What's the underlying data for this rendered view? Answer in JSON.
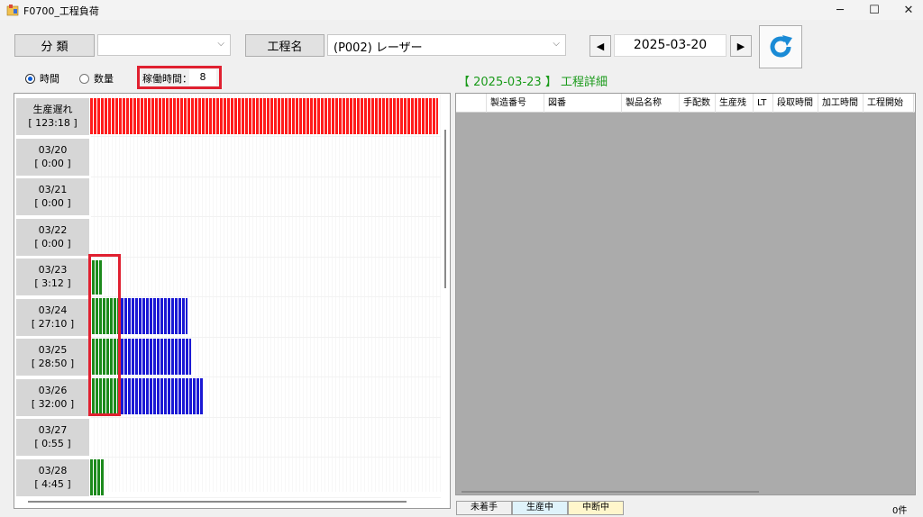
{
  "window": {
    "title": "F0700_工程負荷",
    "minimize": "─",
    "maximize": "☐",
    "close": "✕"
  },
  "toolbar": {
    "category_label": "分 類",
    "category_value": "",
    "process_label": "工程名",
    "process_value": "(P002) レーザー",
    "prev_icon": "◀",
    "date": "2025-03-20",
    "next_icon": "▶"
  },
  "options": {
    "time_label": "時間",
    "quantity_label": "数量",
    "selected": "time",
    "work_hours_label": "稼働時間：",
    "work_hours_value": "8"
  },
  "load_rows": [
    {
      "label": "生産遅れ",
      "total": "[ 123:18 ]"
    },
    {
      "label": "03/20",
      "total": "[ 0:00 ]"
    },
    {
      "label": "03/21",
      "total": "[ 0:00 ]"
    },
    {
      "label": "03/22",
      "total": "[ 0:00 ]"
    },
    {
      "label": "03/23",
      "total": "[ 3:12 ]"
    },
    {
      "label": "03/24",
      "total": "[ 27:10 ]"
    },
    {
      "label": "03/25",
      "total": "[ 28:50 ]"
    },
    {
      "label": "03/26",
      "total": "[ 32:00 ]"
    },
    {
      "label": "03/27",
      "total": "[ 0:55 ]"
    },
    {
      "label": "03/28",
      "total": "[ 4:45 ]"
    }
  ],
  "detail": {
    "title": "【 2025-03-23 】 工程詳細",
    "columns": [
      "",
      "製造番号",
      "図番",
      "製品名称",
      "手配数",
      "生産残",
      "LT",
      "段取時間",
      "加工時間",
      "工程開始"
    ]
  },
  "legend": {
    "not_started": "未着手",
    "in_production": "生産中",
    "suspended": "中断中",
    "not_started_color": "#ffffff",
    "in_production_color": "#dff3fb",
    "suspended_color": "#fff6cc"
  },
  "record_count": "0件",
  "colors": {
    "delay": "#ff1b1b",
    "in_progress": "#1c8a1c",
    "planned": "#1a18d4",
    "highlight": "#e02030",
    "refresh": "#1a8bd6"
  }
}
